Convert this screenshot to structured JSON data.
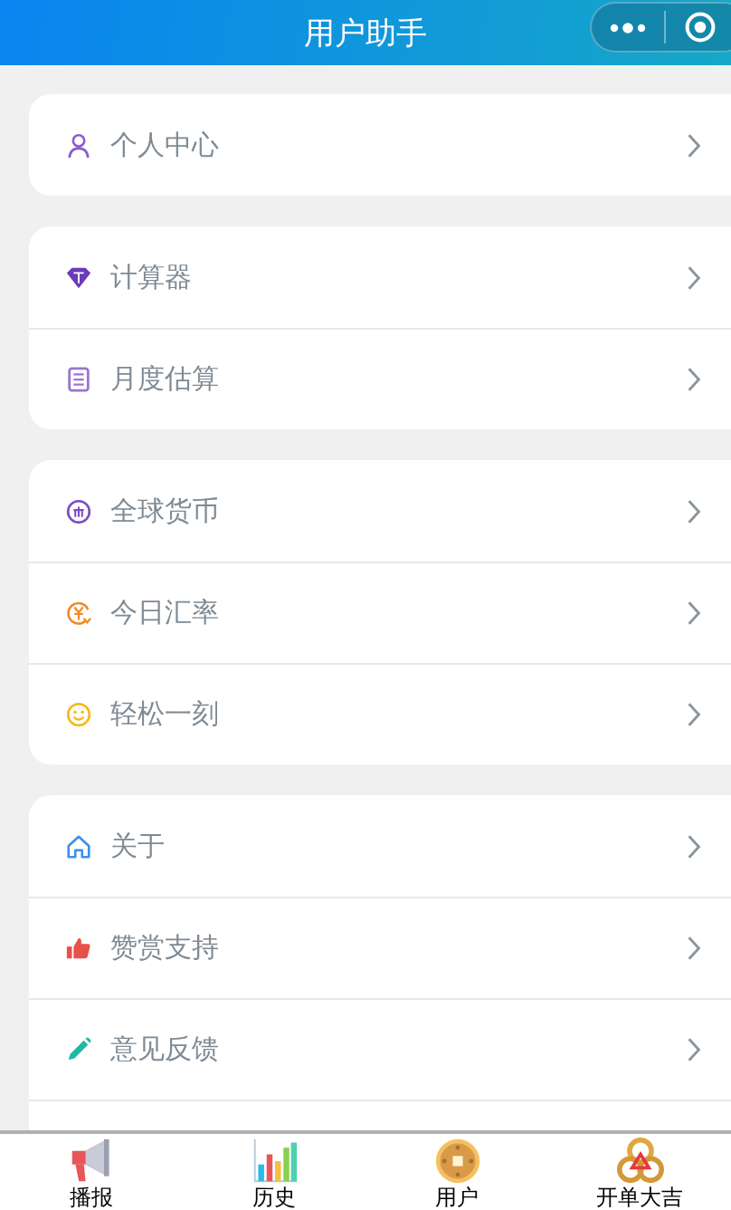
{
  "header": {
    "title": "用户助手"
  },
  "groups": [
    {
      "items": [
        {
          "kind": "user",
          "label": "个人中心"
        }
      ]
    },
    {
      "items": [
        {
          "kind": "diamond",
          "label": "计算器"
        },
        {
          "kind": "memo",
          "label": "月度估算"
        }
      ]
    },
    {
      "items": [
        {
          "kind": "currency",
          "label": "全球货币"
        },
        {
          "kind": "exchange",
          "label": "今日汇率"
        },
        {
          "kind": "smile",
          "label": "轻松一刻"
        }
      ]
    },
    {
      "items": [
        {
          "kind": "home",
          "label": "关于"
        },
        {
          "kind": "thumb",
          "label": "赞赏支持"
        },
        {
          "kind": "pencil",
          "label": "意见反馈"
        }
      ]
    }
  ],
  "tabbar": [
    {
      "kind": "megaphone",
      "label": "播报"
    },
    {
      "kind": "chart",
      "label": "历史"
    },
    {
      "kind": "coin",
      "label": "用户"
    },
    {
      "kind": "rings",
      "label": "开单大吉"
    }
  ]
}
